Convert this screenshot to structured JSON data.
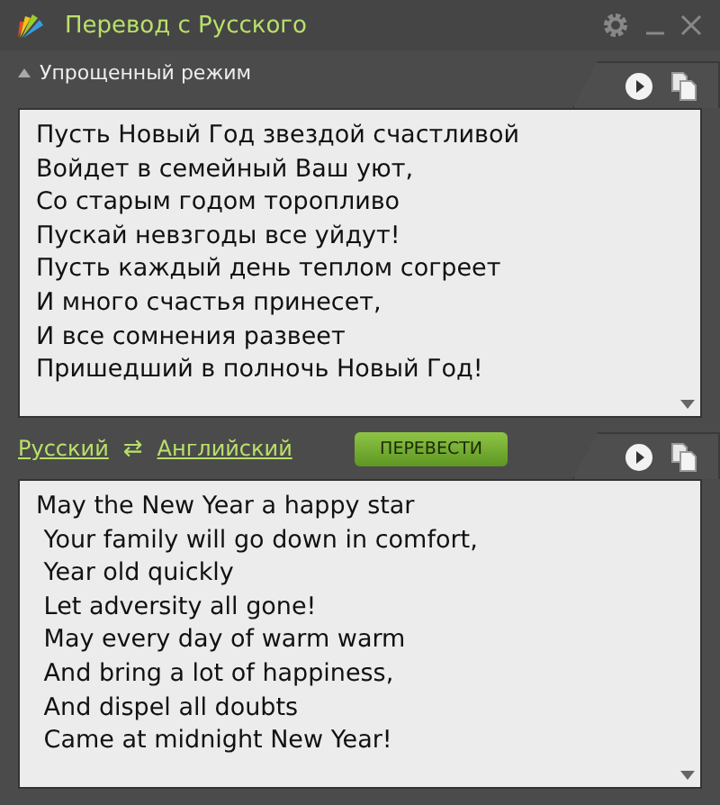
{
  "window": {
    "title": "Перевод с Русского"
  },
  "mode": {
    "label": "Упрощенный режим",
    "expanded": true
  },
  "source": {
    "text": [
      "Пусть Новый Год звездой счастливой",
      "Войдет в семейный Ваш уют,",
      "Со старым годом торопливо",
      "Пускай невзгоды все уйдут!",
      "Пусть каждый день теплом согреет",
      "И много счастья принесет,",
      "И все сомнения развеет",
      "Пришедший в полночь Новый Год!"
    ]
  },
  "languages": {
    "from": "Русский",
    "swap": "⇄",
    "to": "Английский"
  },
  "translate_button": "ПЕРЕВЕСТИ",
  "result": {
    "text": [
      "May the New Year a happy star",
      " Your family will go down in comfort,",
      " Year old quickly",
      " Let adversity all gone!",
      " May every day of warm warm",
      " And bring a lot of happiness,",
      " And dispel all doubts",
      " Came at midnight New Year!"
    ]
  }
}
